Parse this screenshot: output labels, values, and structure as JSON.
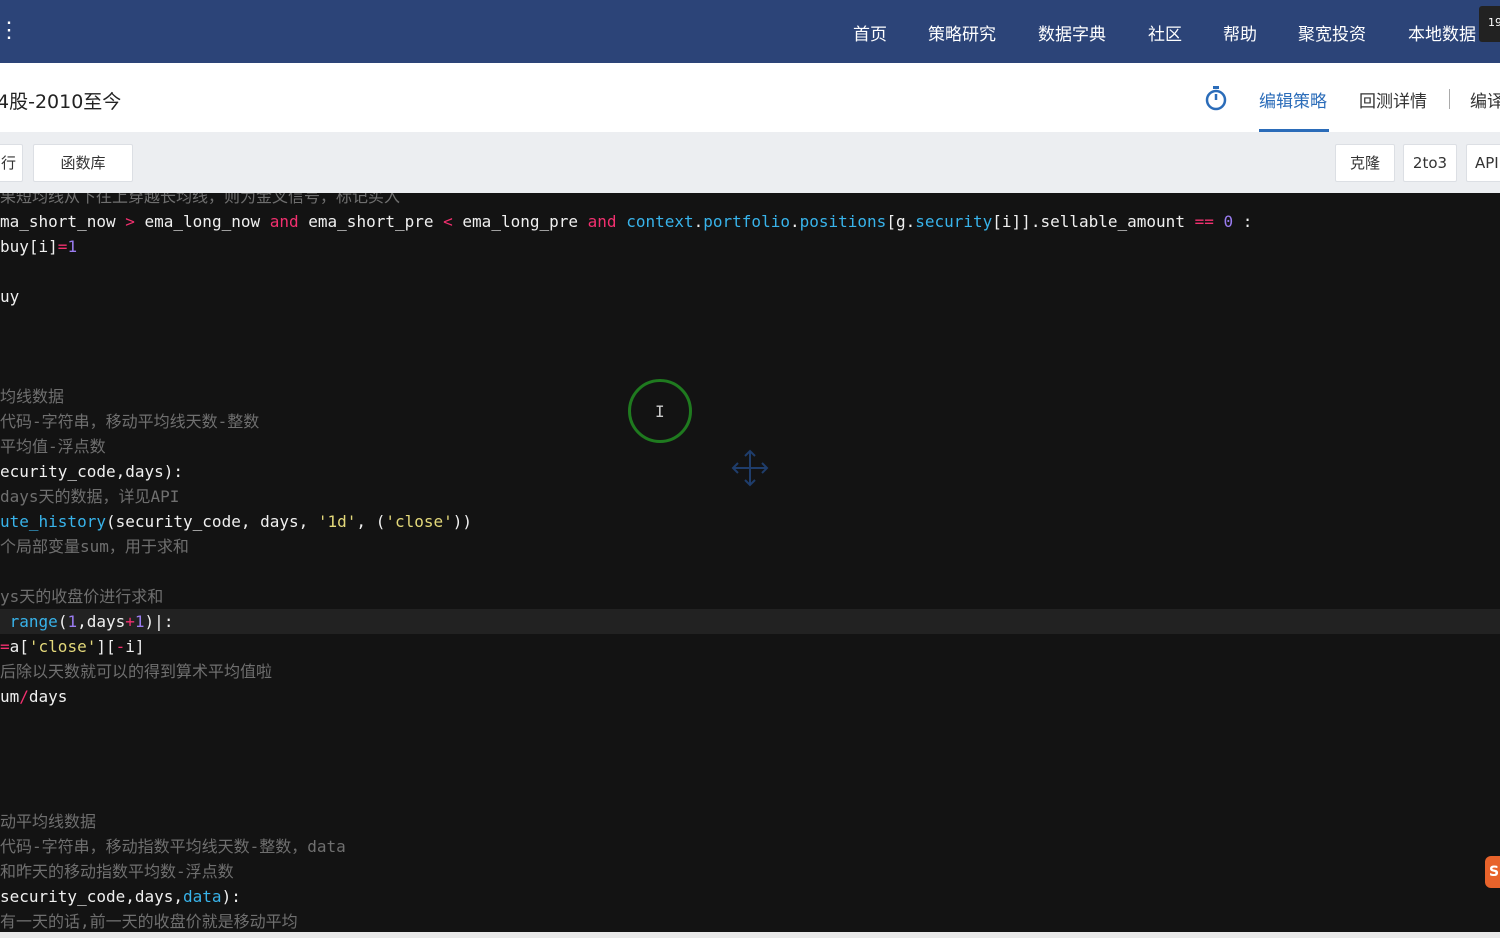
{
  "topnav": {
    "dots": "⋮",
    "items": [
      "首页",
      "策略研究",
      "数据字典",
      "社区",
      "帮助",
      "聚宽投资",
      "本地数据"
    ],
    "badge": "19"
  },
  "titlebar": {
    "title": "4股-2010至今",
    "tabs": [
      "编辑策略",
      "回测详情",
      "编译"
    ],
    "active_tab": "编辑策略",
    "accent": "#2b6cb9"
  },
  "toolbar": {
    "left_buttons": [
      "行",
      "函数库"
    ],
    "right_buttons": [
      "克隆",
      "2to3",
      "API"
    ]
  },
  "editor": {
    "highlighted_line_index": 17,
    "lines": [
      [
        [
          "c",
          "果短均线从下往上穿越长均线，则为金叉信号，标记买入"
        ]
      ],
      [
        [
          "w",
          "ma_short_now "
        ],
        [
          "o",
          ">"
        ],
        [
          "w",
          " ema_long_now "
        ],
        [
          "k",
          "and"
        ],
        [
          "w",
          " ema_short_pre "
        ],
        [
          "o",
          "<"
        ],
        [
          "w",
          " ema_long_pre "
        ],
        [
          "k",
          "and"
        ],
        [
          "w",
          " "
        ],
        [
          "f",
          "context"
        ],
        [
          "w",
          "."
        ],
        [
          "f",
          "portfolio"
        ],
        [
          "w",
          "."
        ],
        [
          "f",
          "positions"
        ],
        [
          "w",
          "[g."
        ],
        [
          "f",
          "security"
        ],
        [
          "w",
          "[i]]."
        ],
        [
          "w",
          "sellable_amount "
        ],
        [
          "o",
          "=="
        ],
        [
          "w",
          " "
        ],
        [
          "n",
          "0"
        ],
        [
          "w",
          " :"
        ]
      ],
      [
        [
          "w",
          "buy[i]"
        ],
        [
          "o",
          "="
        ],
        [
          "n",
          "1"
        ]
      ],
      [],
      [
        [
          "w",
          "uy"
        ]
      ],
      [],
      [],
      [],
      [
        [
          "c",
          "均线数据"
        ]
      ],
      [
        [
          "c",
          "代码-字符串，移动平均线天数-整数"
        ]
      ],
      [
        [
          "c",
          "平均值-浮点数"
        ]
      ],
      [
        [
          "w",
          "ecurity_code,days):"
        ]
      ],
      [
        [
          "c",
          "days天的数据，详见API"
        ]
      ],
      [
        [
          "f",
          "ute_history"
        ],
        [
          "w",
          "(security_code, days, "
        ],
        [
          "s",
          "'1d'"
        ],
        [
          "w",
          ", ("
        ],
        [
          "s",
          "'close'"
        ],
        [
          "w",
          "))"
        ]
      ],
      [
        [
          "c",
          "个局部变量sum，用于求和"
        ]
      ],
      [],
      [
        [
          "c",
          "ys天的收盘价进行求和"
        ]
      ],
      [
        [
          "w",
          " "
        ],
        [
          "f",
          "range"
        ],
        [
          "w",
          "("
        ],
        [
          "n",
          "1"
        ],
        [
          "w",
          ",days"
        ],
        [
          "o",
          "+"
        ],
        [
          "n",
          "1"
        ],
        [
          "w",
          ")|:"
        ]
      ],
      [
        [
          "o",
          "="
        ],
        [
          "w",
          "a["
        ],
        [
          "s",
          "'close'"
        ],
        [
          "w",
          "]["
        ],
        [
          "o",
          "-"
        ],
        [
          "w",
          "i]"
        ]
      ],
      [
        [
          "c",
          "后除以天数就可以的得到算术平均值啦"
        ]
      ],
      [
        [
          "w",
          "um"
        ],
        [
          "o",
          "/"
        ],
        [
          "w",
          "days"
        ]
      ],
      [],
      [],
      [],
      [],
      [
        [
          "c",
          "动平均线数据"
        ]
      ],
      [
        [
          "c",
          "代码-字符串，移动指数平均线天数-整数，data"
        ]
      ],
      [
        [
          "c",
          "和昨天的移动指数平均数-浮点数"
        ]
      ],
      [
        [
          "w",
          "security_code,days,"
        ],
        [
          "f",
          "data"
        ],
        [
          "w",
          "):"
        ]
      ],
      [
        [
          "c",
          "有一天的话,前一天的收盘价就是移动平均"
        ]
      ]
    ]
  }
}
